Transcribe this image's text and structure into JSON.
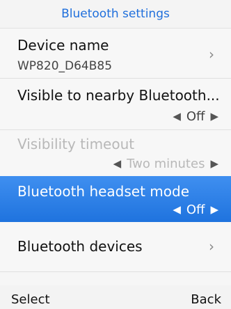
{
  "header": {
    "title": "Bluetooth settings"
  },
  "items": [
    {
      "label": "Device name",
      "sublabel": "WP820_D64B85",
      "chevron": "›"
    },
    {
      "label": "Visible to nearby Bluetooth...",
      "value": "Off",
      "arrow_left": "◀",
      "arrow_right": "▶"
    },
    {
      "label": "Visibility timeout",
      "value": "Two minutes",
      "arrow_left": "◀",
      "arrow_right": "▶"
    },
    {
      "label": "Bluetooth headset mode",
      "value": "Off",
      "arrow_left": "◀",
      "arrow_right": "▶"
    },
    {
      "label": "Bluetooth devices",
      "chevron": "›"
    }
  ],
  "softkeys": {
    "left": "Select",
    "right": "Back"
  },
  "colors": {
    "accent": "#1f73de",
    "selected_bg": "#3f8ff0",
    "title_color": "#1f6fdc",
    "disabled_text": "#b8b8b8"
  }
}
